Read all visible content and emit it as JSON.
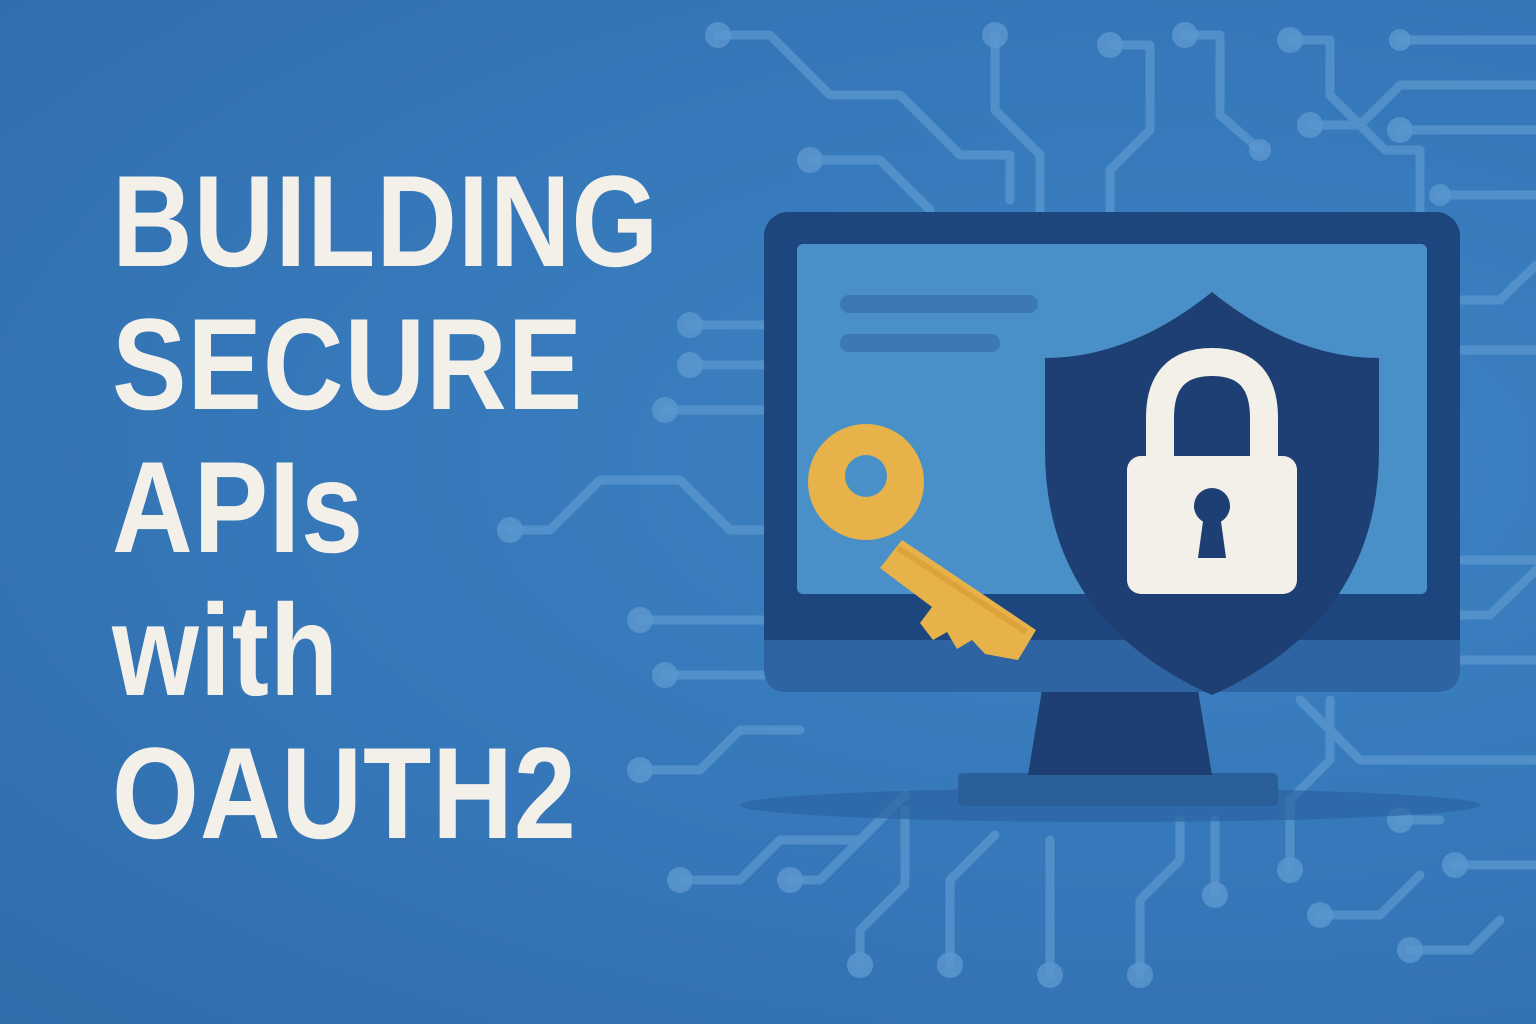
{
  "title": {
    "lines": [
      "BUILDING",
      "SECURE",
      "APIs",
      "with",
      "OAUTH2"
    ]
  },
  "colors": {
    "background": "#3577b8",
    "text": "#f3f0ea",
    "monitor_frame": "#1e467e",
    "screen": "#4a90c8",
    "shield": "#1d3f73",
    "lock": "#f3f0ea",
    "key": "#e8b24a",
    "circuit": "#5a97cf"
  },
  "icons": [
    "circuit-board-pattern",
    "monitor-icon",
    "shield-icon",
    "padlock-icon",
    "key-icon"
  ]
}
